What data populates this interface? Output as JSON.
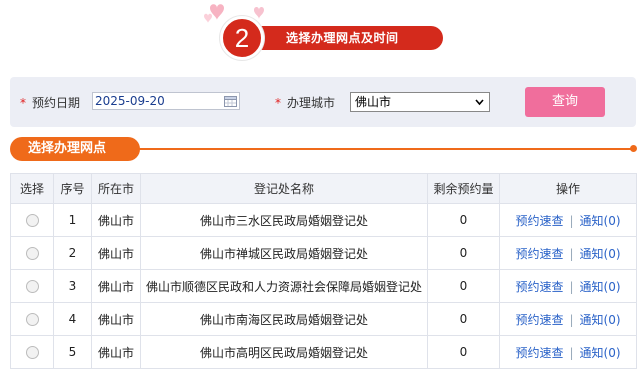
{
  "step": {
    "number": "2",
    "title": "选择办理网点及时间"
  },
  "search": {
    "date_label": "预约日期",
    "date_value": "2025-09-20",
    "city_label": "办理城市",
    "city_value": "佛山市",
    "query_label": "查询"
  },
  "section": {
    "title": "选择办理网点"
  },
  "table": {
    "headers": [
      "选择",
      "序号",
      "所在市",
      "登记处名称",
      "剩余预约量",
      "操作"
    ],
    "rows": [
      {
        "seq": "1",
        "city": "佛山市",
        "name": "佛山市三水区民政局婚姻登记处",
        "remaining": "0",
        "book": "预约速查",
        "notice": "通知(0)"
      },
      {
        "seq": "2",
        "city": "佛山市",
        "name": "佛山市禅城区民政局婚姻登记处",
        "remaining": "0",
        "book": "预约速查",
        "notice": "通知(0)"
      },
      {
        "seq": "3",
        "city": "佛山市",
        "name": "佛山市顺德区民政和人力资源社会保障局婚姻登记处",
        "remaining": "0",
        "book": "预约速查",
        "notice": "通知(0)"
      },
      {
        "seq": "4",
        "city": "佛山市",
        "name": "佛山市南海区民政局婚姻登记处",
        "remaining": "0",
        "book": "预约速查",
        "notice": "通知(0)"
      },
      {
        "seq": "5",
        "city": "佛山市",
        "name": "佛山市高明区民政局婚姻登记处",
        "remaining": "0",
        "book": "预约速查",
        "notice": "通知(0)"
      }
    ]
  },
  "colors": {
    "brand_red": "#d42a1c",
    "orange": "#ef6a1a",
    "pink_button": "#f06e9c",
    "link_blue": "#2a62c8",
    "count_red": "#e02020"
  },
  "icons": [
    "hearts-decoration-icon",
    "calendar-icon",
    "chevron-down-icon"
  ]
}
